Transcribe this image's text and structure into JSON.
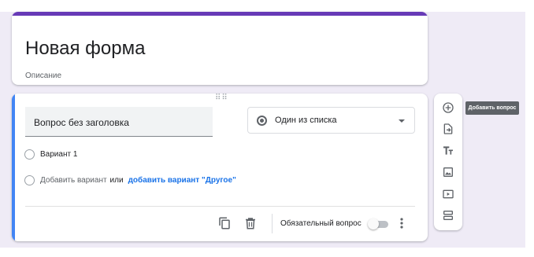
{
  "form": {
    "title": "Новая форма",
    "description": "Описание",
    "accent_color": "#673ab7"
  },
  "question": {
    "title": "Вопрос без заголовка",
    "type_selected": "Один из списка",
    "type_icon": "radio-button-icon",
    "options": [
      {
        "label": "Вариант 1"
      }
    ],
    "add_option_label": "Добавить вариант",
    "or_label": "или",
    "add_other_label": "добавить вариант \"Другое\"",
    "required_label": "Обязательный вопрос",
    "required_on": false,
    "accent_color": "#4285f4"
  },
  "footer_icons": [
    "duplicate-icon",
    "delete-icon",
    "more-vert-icon"
  ],
  "toolbar": {
    "items": [
      {
        "icon": "add-circle-icon",
        "name": "add-question"
      },
      {
        "icon": "import-icon",
        "name": "import-questions"
      },
      {
        "icon": "title-text-icon",
        "name": "add-title"
      },
      {
        "icon": "image-icon",
        "name": "add-image"
      },
      {
        "icon": "video-icon",
        "name": "add-video"
      },
      {
        "icon": "section-icon",
        "name": "add-section"
      }
    ],
    "tooltip": "Добавить вопрос"
  },
  "colors": {
    "background": "#efebf6",
    "link": "#1a73e8",
    "tooltip_bg": "#5f6368"
  }
}
